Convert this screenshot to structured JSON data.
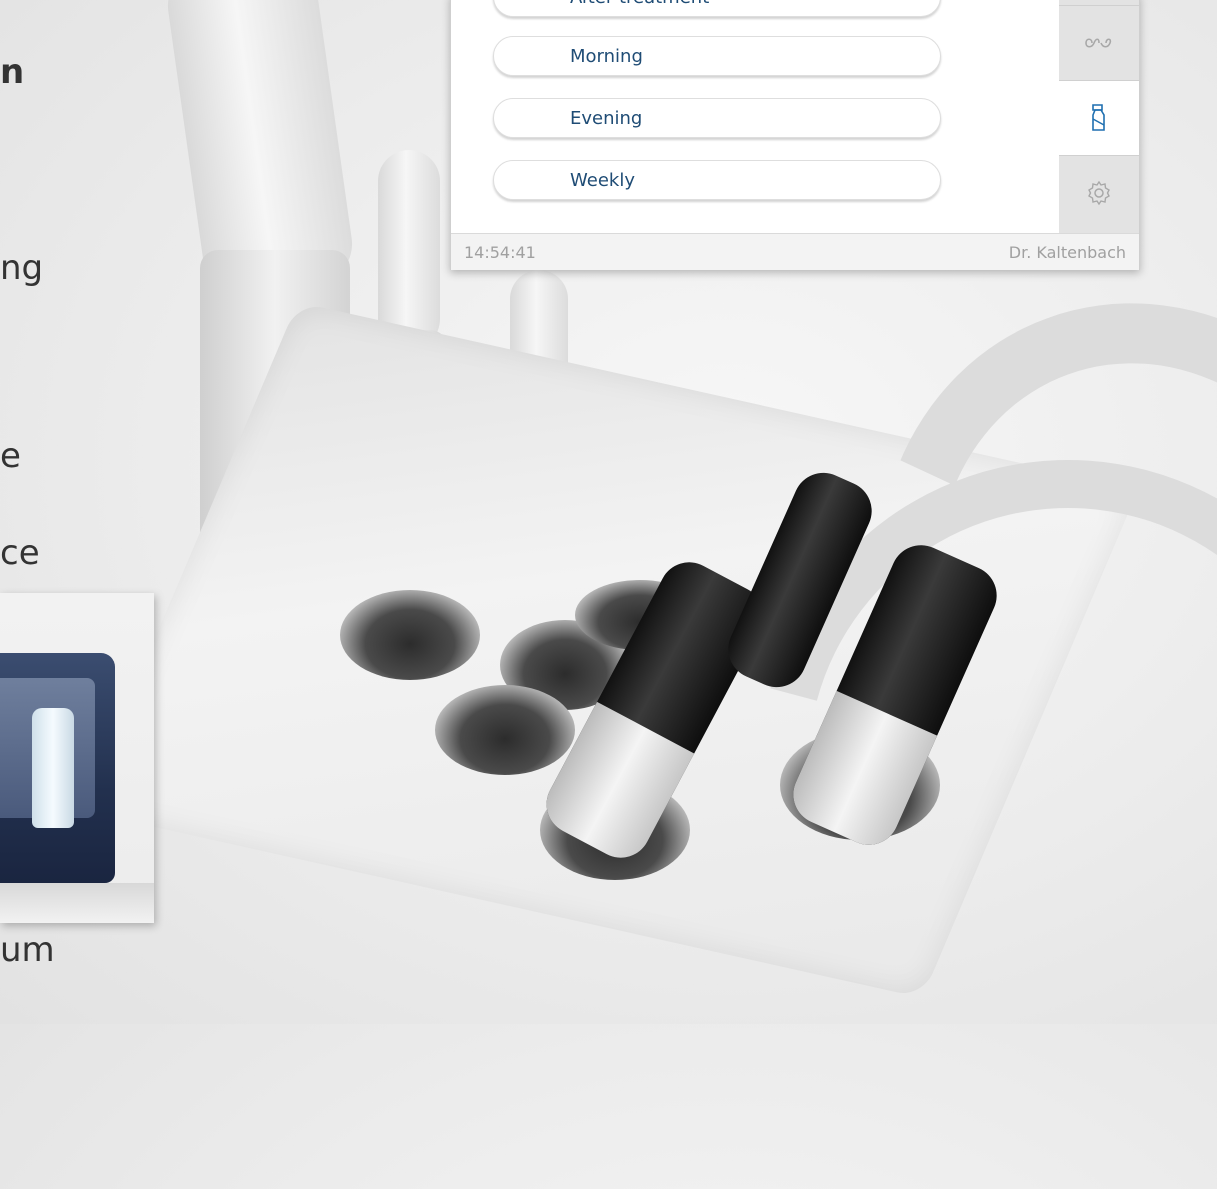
{
  "device_panel": {
    "menu_items": [
      {
        "label": "After treatment"
      },
      {
        "label": "Morning"
      },
      {
        "label": "Evening"
      },
      {
        "label": "Weekly"
      }
    ],
    "side_tabs": [
      {
        "icon": "infinity-icon",
        "active": false
      },
      {
        "icon": "spray-bottle-icon",
        "active": true
      },
      {
        "icon": "gear-icon",
        "active": false
      }
    ],
    "footer": {
      "time": "14:54:41",
      "user": "Dr. Kaltenbach"
    },
    "colors": {
      "label": "#1f4c75",
      "active_icon": "#1f6fb0",
      "inactive_icon": "#a8a8a8"
    }
  },
  "slide_text": {
    "line1": "n",
    "line2": "ng",
    "line3": "e",
    "line4": "ce",
    "line5": "um"
  }
}
